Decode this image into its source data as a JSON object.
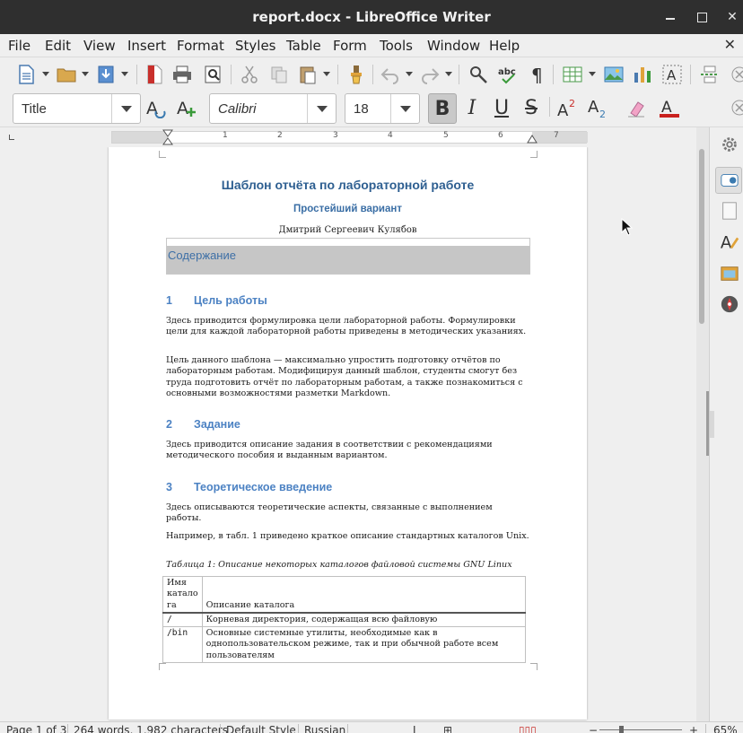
{
  "window": {
    "title": "report.docx - LibreOffice Writer"
  },
  "menu": [
    "File",
    "Edit",
    "View",
    "Insert",
    "Format",
    "Styles",
    "Table",
    "Form",
    "Tools",
    "Window",
    "Help"
  ],
  "formatting": {
    "paragraph_style": "Title",
    "font_name": "Calibri",
    "font_size": "18",
    "bold_active": true
  },
  "ruler": {
    "labels": [
      "1",
      "2",
      "3",
      "4",
      "5",
      "6",
      "7"
    ]
  },
  "document": {
    "title": "Шаблон отчёта по лабораторной работе",
    "subtitle": "Простейший вариант",
    "author": "Дмитрий Сергеевич Кулябов",
    "toc_title": "Содержание",
    "sections": [
      {
        "number": "1",
        "title": "Цель работы",
        "paragraphs": [
          "Здесь приводится формулировка цели лабораторной работы. Формулировки цели для каждой лабораторной работы приведены в методических указаниях.",
          "Цель данного шаблона — максимально упростить подготовку отчётов по лабораторным работам. Модифицируя данный шаблон, студенты смогут без труда подготовить отчёт по лабораторным работам, а также познакомиться с основными возможностями разметки Markdown."
        ]
      },
      {
        "number": "2",
        "title": "Задание",
        "paragraphs": [
          "Здесь приводится описание задания в соответствии с рекомендациями методического пособия и выданным вариантом."
        ]
      },
      {
        "number": "3",
        "title": "Теоретическое введение",
        "paragraphs": [
          "Здесь описываются теоретические аспекты, связанные с выполнением работы.",
          "Например, в табл. 1 приведено краткое описание стандартных каталогов Unix."
        ]
      }
    ],
    "table_caption": "Таблица 1: Описание некоторых каталогов файловой системы GNU Linux",
    "table": {
      "headers": [
        "Имя катало га",
        "Описание каталога"
      ],
      "rows": [
        [
          "/",
          "Корневая директория, содержащая всю файловую"
        ],
        [
          "/bin",
          "Основные системные утилиты, необходимые как в однопользовательском режиме, так и при обычной работе всем пользователям"
        ]
      ]
    }
  },
  "statusbar": {
    "page": "Page 1 of 3",
    "words": "264 words, 1,982 characters",
    "page_style": "Default Style",
    "language": "Russian",
    "zoom": "65%"
  }
}
